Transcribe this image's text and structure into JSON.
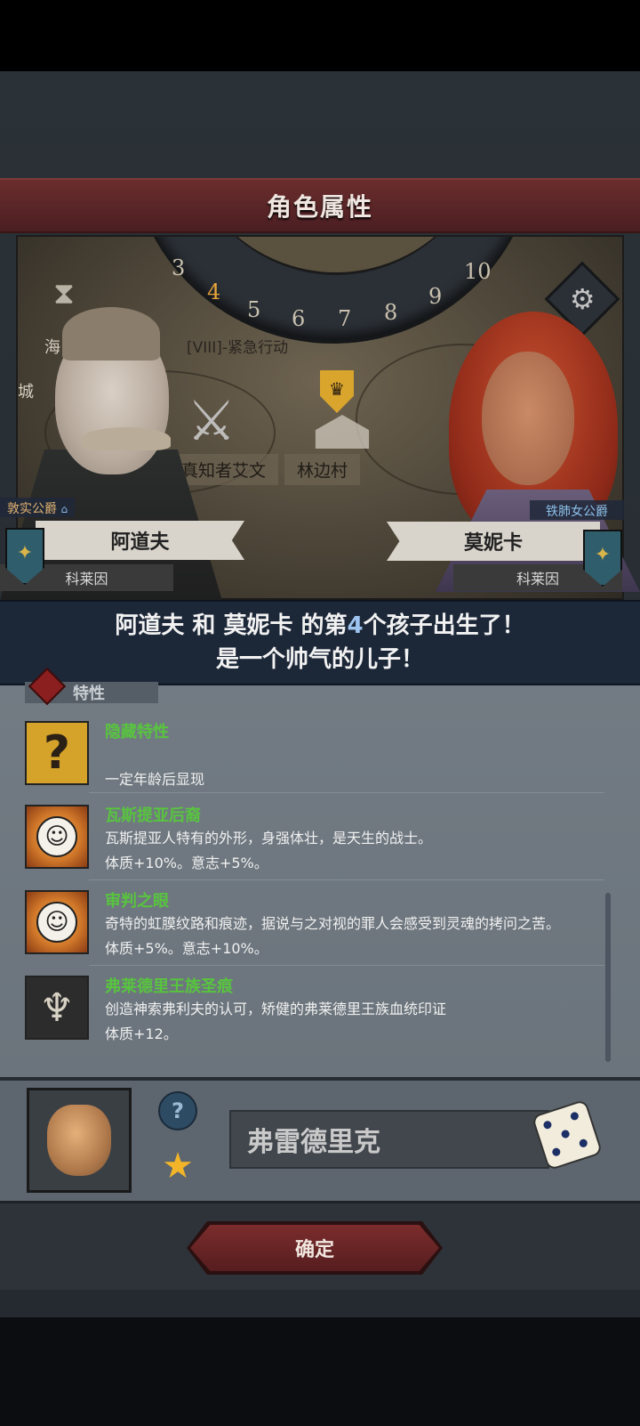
{
  "header": {
    "title": "角色属性"
  },
  "scene": {
    "dial_numbers": [
      "3",
      "4",
      "5",
      "6",
      "7",
      "8",
      "9",
      "10"
    ],
    "active_turn": "4",
    "turn_label": "[VIII]-紧急行动",
    "left_location": "真知者艾文",
    "right_location": "林边村",
    "map_fragments": [
      "海",
      "城"
    ]
  },
  "father": {
    "rank": "敦实公爵",
    "name": "阿道夫",
    "house": "科莱因"
  },
  "mother": {
    "rank": "铁肺女公爵",
    "name": "莫妮卡",
    "house": "科莱因"
  },
  "announcement": {
    "line1_a": "阿道夫 和 莫妮卡 的第",
    "line1_num": "4",
    "line1_b": "个孩子出生了！",
    "line2": "是一个帅气的儿子！"
  },
  "traits_section": {
    "title": "特性"
  },
  "traits": [
    {
      "icon": "question-mark-icon",
      "name": "隐藏特性",
      "desc": "",
      "desc2": "一定年龄后显现"
    },
    {
      "icon": "smile-icon",
      "name": "瓦斯提亚后裔",
      "desc": "瓦斯提亚人特有的外形，身强体壮，是天生的战士。",
      "desc2": "体质+10%。意志+5%。"
    },
    {
      "icon": "smile-icon",
      "name": "审判之眼",
      "desc": "奇特的虹膜纹路和痕迹，据说与之对视的罪人会感受到灵魂的拷问之苦。",
      "desc2": "体质+5%。意志+10%。"
    },
    {
      "icon": "royal-crest-icon",
      "name": "弗莱德里王族圣痕",
      "desc": "创造神索弗利夫的认可，矫健的弗莱德里王族血统印证",
      "desc2": "体质+12。"
    }
  ],
  "child": {
    "name": "弗雷德里克"
  },
  "confirm_label": "确定",
  "colors": {
    "title_bar": "#5a2428",
    "announce": "#1c2738",
    "trait_name": "#58c43f",
    "star": "#f2b52a"
  }
}
